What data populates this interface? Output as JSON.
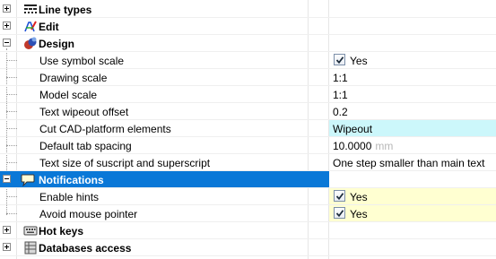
{
  "tree": {
    "line_types": {
      "label": "Line types"
    },
    "edit": {
      "label": "Edit"
    },
    "design": {
      "label": "Design",
      "props": [
        {
          "name": "Use symbol scale",
          "value": "Yes",
          "checked": true
        },
        {
          "name": "Drawing scale",
          "value": "1:1"
        },
        {
          "name": "Model scale",
          "value": "1:1"
        },
        {
          "name": "Text wipeout offset",
          "value": "0.2"
        },
        {
          "name": "Cut CAD-platform elements",
          "value": "Wipeout",
          "highlight": "#ccf7fb"
        },
        {
          "name": "Default tab spacing",
          "value": "10.0000",
          "unit": "mm"
        },
        {
          "name": "Text size of suscript and superscript",
          "value": "One step smaller than main text"
        }
      ]
    },
    "notifications": {
      "label": "Notifications",
      "props": [
        {
          "name": "Enable hints",
          "value": "Yes",
          "checked": true,
          "highlight": "#ffffd1"
        },
        {
          "name": "Avoid mouse pointer",
          "value": "Yes",
          "checked": true,
          "highlight": "#ffffd1"
        }
      ]
    },
    "hot_keys": {
      "label": "Hot keys"
    },
    "databases_access": {
      "label": "Databases access"
    }
  },
  "colors": {
    "selection": "#0a78d7",
    "cyan_highlight": "#ccf7fb",
    "yellow_highlight": "#ffffd1"
  }
}
